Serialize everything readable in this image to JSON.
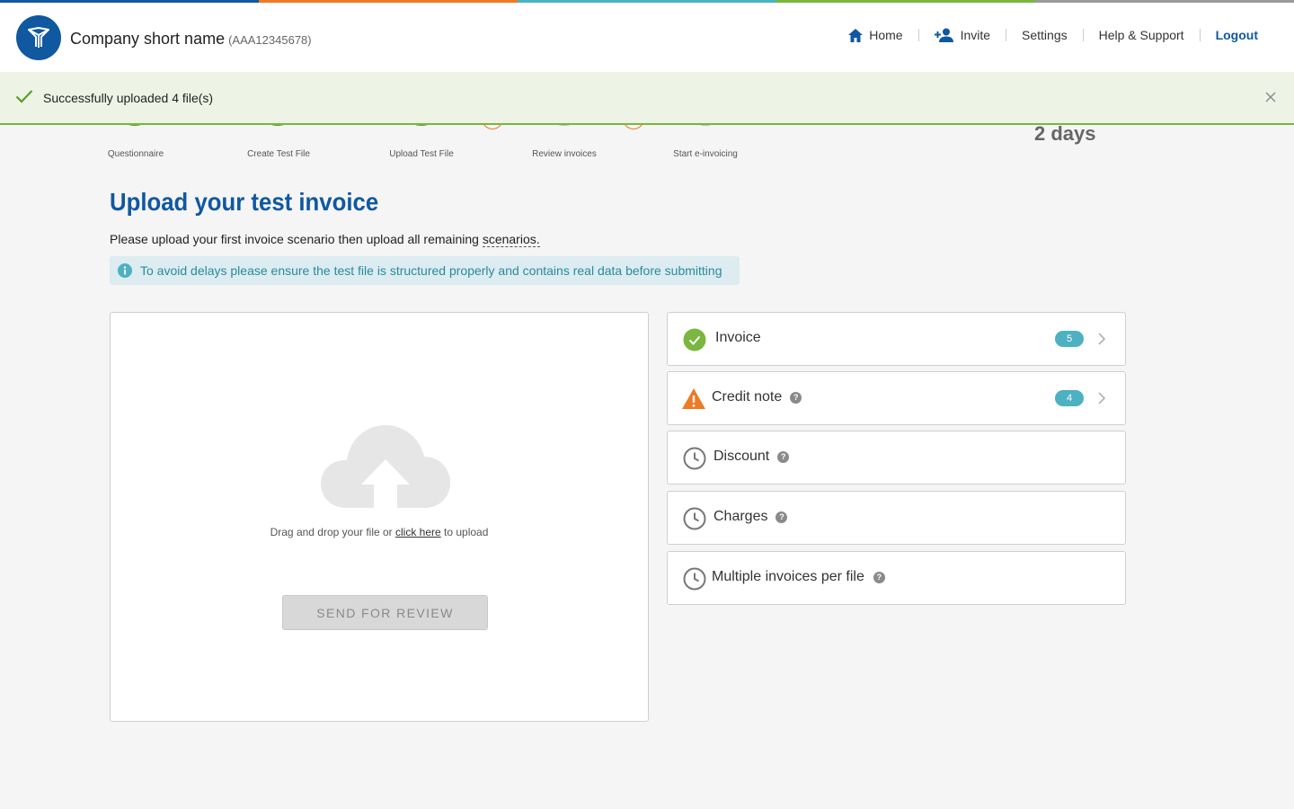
{
  "colors": {
    "stripe": [
      "#1058a0",
      "#ee7a24",
      "#4cb1c1",
      "#7ab640",
      "#9a9a9a"
    ],
    "brand": "#1058a0",
    "success": "#7ab640",
    "warning": "#ee7a24",
    "badge": "#4cb1c1"
  },
  "header": {
    "company_name": "Company short name",
    "company_code": "(AAA12345678)",
    "nav": {
      "home": "Home",
      "invite": "Invite",
      "settings": "Settings",
      "help": "Help & Support",
      "logout": "Logout"
    }
  },
  "banner": {
    "message": "Successfully uploaded 4 file(s)"
  },
  "steps": [
    {
      "label": "Questionnaire",
      "state": "done"
    },
    {
      "label": "Create Test File",
      "state": "done"
    },
    {
      "label": "Upload Test File",
      "state": "current"
    },
    {
      "label": "Review invoices",
      "state": "pending"
    },
    {
      "label": "Start e-invoicing",
      "state": "pending"
    }
  ],
  "timer": {
    "value": "2 days"
  },
  "page": {
    "title": "Upload your test invoice",
    "subtitle_pre": "Please upload your first invoice scenario then upload all remaining ",
    "subtitle_link": "scenarios.",
    "info": "To avoid delays please ensure the test file is structured properly and contains real data before submitting"
  },
  "upload": {
    "hint_pre": "Drag and drop your file or ",
    "hint_link": "click here",
    "hint_post": " to upload",
    "send_button": "SEND FOR REVIEW",
    "icon": "cloud-upload-icon"
  },
  "scenarios": [
    {
      "label": "Invoice",
      "status": "success",
      "icon": "check-circle-icon",
      "count": "5",
      "help": false
    },
    {
      "label": "Credit note",
      "status": "warning",
      "icon": "warning-triangle-icon",
      "count": "4",
      "help": true
    },
    {
      "label": "Discount",
      "status": "pending",
      "icon": "clock-icon",
      "help": true
    },
    {
      "label": "Charges",
      "status": "pending",
      "icon": "clock-icon",
      "help": true
    },
    {
      "label": "Multiple invoices per file",
      "status": "pending",
      "icon": "clock-icon",
      "help": true
    }
  ],
  "help_glyph": "?"
}
